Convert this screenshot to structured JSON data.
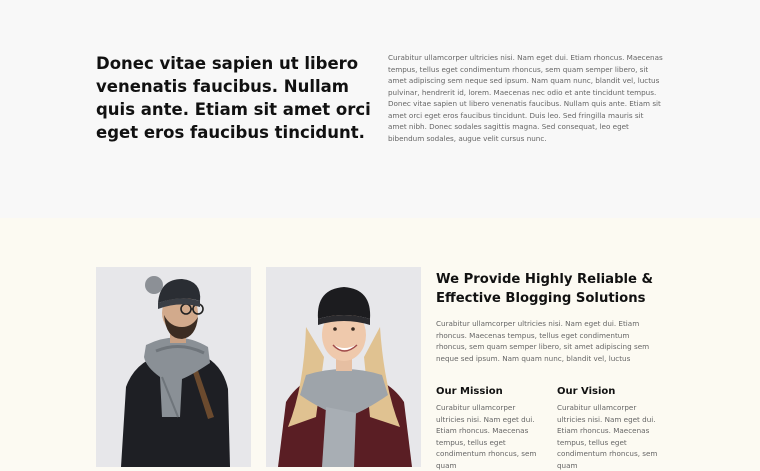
{
  "intro": {
    "heading": "Donec vitae sapien ut libero venenatis faucibus. Nullam quis ante. Etiam sit amet orci eget eros faucibus tincidunt.",
    "text": "Curabitur ullamcorper ultricies nisi. Nam eget dui. Etiam rhoncus. Maecenas tempus, tellus eget condimentum rhoncus, sem quam semper libero, sit amet adipiscing sem neque sed ipsum. Nam quam nunc, blandit vel, luctus pulvinar, hendrerit id, lorem. Maecenas nec odio et ante tincidunt tempus. Donec vitae sapien ut libero venenatis faucibus. Nullam quis ante. Etiam sit amet orci eget eros faucibus tincidunt. Duis leo. Sed fringilla mauris sit amet nibh. Donec sodales sagittis magna. Sed consequat, leo eget bibendum sodales, augue velit cursus nunc."
  },
  "features": {
    "title": "We Provide Highly Reliable & Effective Blogging Solutions",
    "text": "Curabitur ullamcorper ultricies nisi. Nam eget dui. Etiam rhoncus. Maecenas tempus, tellus eget condimentum rhoncus, sem quam semper libero, sit amet adipiscing sem neque sed ipsum. Nam quam nunc, blandit vel, luctus",
    "mission": {
      "title": "Our Mission",
      "text": "Curabitur ullamcorper ultricies nisi. Nam eget dui. Etiam rhoncus. Maecenas tempus, tellus eget condimentum rhoncus, sem quam"
    },
    "vision": {
      "title": "Our Vision",
      "text": "Curabitur ullamcorper ultricies nisi. Nam eget dui. Etiam rhoncus. Maecenas tempus, tellus eget condimentum rhoncus, sem quam"
    }
  },
  "colors": {
    "intro_bg": "#f8f8f8",
    "features_bg": "#fcfaf2",
    "heading": "#111111",
    "body_text": "#666666",
    "photo_bg": "#e6e6ea"
  }
}
